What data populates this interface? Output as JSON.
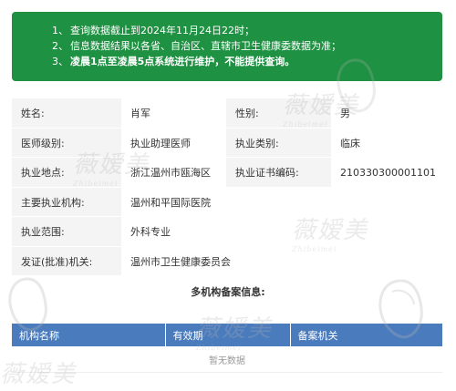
{
  "notice": {
    "items": [
      {
        "num": "1、",
        "text": "查询数据截止到2024年11月24日22时；",
        "bold": false
      },
      {
        "num": "2、",
        "text": "信息数据结果以各省、自治区、直辖市卫生健康委数据为准；",
        "bold": false
      },
      {
        "num": "3、",
        "text": "凌晨1点至凌晨5点系统进行维护，不能提供查询。",
        "bold": true
      }
    ]
  },
  "info": {
    "name_label": "姓名:",
    "name_value": "肖军",
    "gender_label": "性别:",
    "gender_value": "男",
    "level_label": "医师级别:",
    "level_value": "执业助理医师",
    "category_label": "执业类别:",
    "category_value": "临床",
    "location_label": "执业地点:",
    "location_value": "浙江温州市瓯海区",
    "cert_label": "执业证书编码:",
    "cert_value": "210330300001101",
    "org_label": "主要执业机构:",
    "org_value": "温州和平国际医院",
    "scope_label": "执业范围:",
    "scope_value": "外科专业",
    "issuer_label": "发证(批准)机关:",
    "issuer_value": "温州市卫生健康委员会"
  },
  "multi": {
    "title": "多机构备案信息:",
    "headers": [
      "机构名称",
      "有效期",
      "备案机关"
    ],
    "empty_text": "暂无数据"
  },
  "watermark": {
    "brand": "薇嫒美",
    "brand_sub": "Zhibeimei"
  },
  "colors": {
    "notice_bg": "#1e9142",
    "label_bg": "#f4f4f4",
    "table_header_bg": "#4a7bbd"
  }
}
